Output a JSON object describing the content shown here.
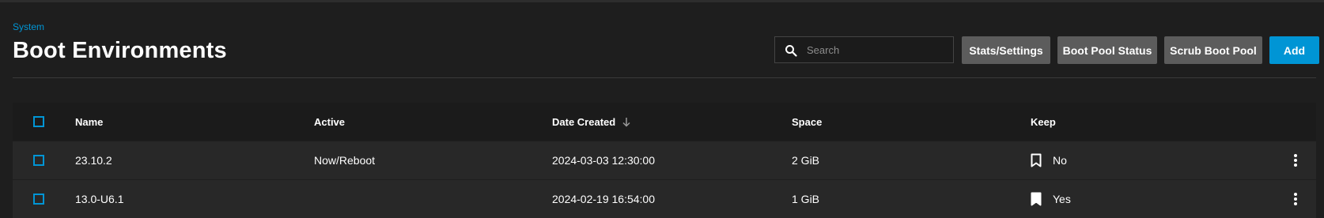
{
  "breadcrumb": "System",
  "page": {
    "title": "Boot Environments"
  },
  "search": {
    "placeholder": "Search"
  },
  "toolbar": {
    "stats_label": "Stats/Settings",
    "boot_pool_status_label": "Boot Pool Status",
    "scrub_boot_pool_label": "Scrub Boot Pool",
    "add_label": "Add"
  },
  "table": {
    "columns": [
      "Name",
      "Active",
      "Date Created",
      "Space",
      "Keep"
    ],
    "sort": {
      "column": "Date Created",
      "direction": "descending",
      "icon": "arrow-down-icon"
    },
    "rows": [
      {
        "name": "23.10.2",
        "active": "Now/Reboot",
        "date_created": "2024-03-03 12:30:00",
        "space": "2 GiB",
        "keep": "No",
        "keep_icon": "bookmark-outline-icon"
      },
      {
        "name": "13.0-U6.1",
        "active": "",
        "date_created": "2024-02-19 16:54:00",
        "space": "1 GiB",
        "keep": "Yes",
        "keep_icon": "bookmark-filled-icon"
      }
    ]
  },
  "colors": {
    "accent": "#0095d5",
    "background": "#1e1e1e",
    "button": "#5c5c5c",
    "row": "#282828",
    "header": "#1b1b1b"
  }
}
